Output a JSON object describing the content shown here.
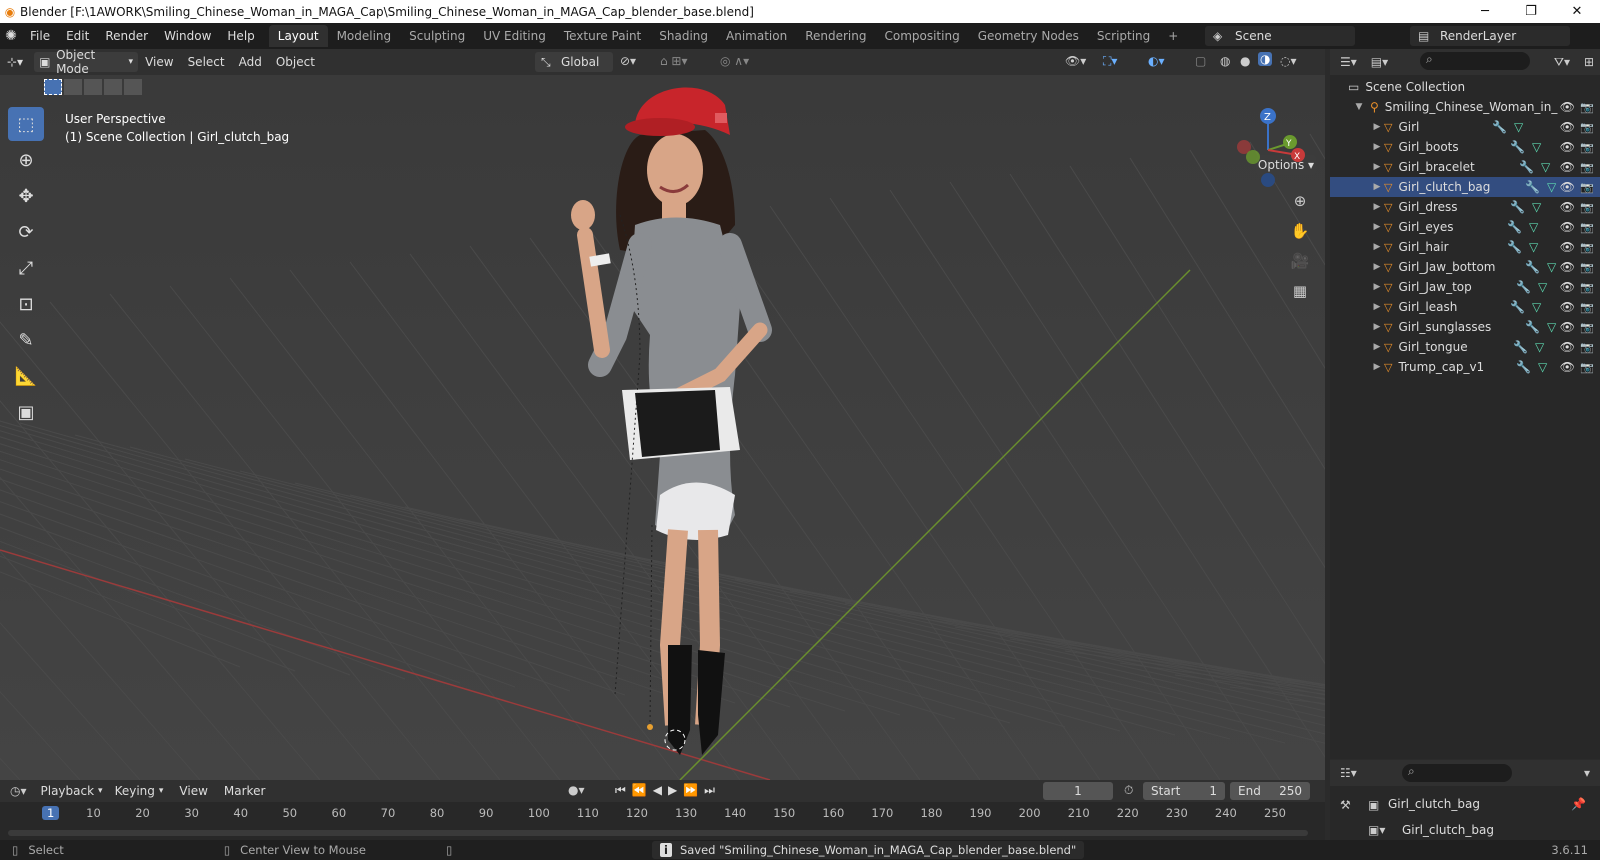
{
  "window": {
    "title": "Blender [F:\\1AWORK\\Smiling_Chinese_Woman_in_MAGA_Cap\\Smiling_Chinese_Woman_in_MAGA_Cap_blender_base.blend]"
  },
  "menu": [
    "File",
    "Edit",
    "Render",
    "Window",
    "Help"
  ],
  "workspaces": [
    "Layout",
    "Modeling",
    "Sculpting",
    "UV Editing",
    "Texture Paint",
    "Shading",
    "Animation",
    "Rendering",
    "Compositing",
    "Geometry Nodes",
    "Scripting"
  ],
  "active_workspace": "Layout",
  "scene": "Scene",
  "render_layer": "RenderLayer",
  "viewport_header": {
    "mode": "Object Mode",
    "menus": [
      "View",
      "Select",
      "Add",
      "Object"
    ],
    "transform": "Global",
    "options": "Options"
  },
  "viewport": {
    "perspective": "User Perspective",
    "collection_info": "(1) Scene Collection | Girl_clutch_bag"
  },
  "gizmo": {
    "z": "Z",
    "y": "Y",
    "x": "X"
  },
  "outliner": {
    "root": "Scene Collection",
    "collection": "Smiling_Chinese_Woman_in_",
    "items": [
      "Girl",
      "Girl_boots",
      "Girl_bracelet",
      "Girl_clutch_bag",
      "Girl_dress",
      "Girl_eyes",
      "Girl_hair",
      "Girl_Jaw_bottom",
      "Girl_Jaw_top",
      "Girl_leash",
      "Girl_sunglasses",
      "Girl_tongue",
      "Trump_cap_v1"
    ],
    "selected": "Girl_clutch_bag"
  },
  "properties": {
    "object": "Girl_clutch_bag",
    "sub": "Girl_clutch_bag"
  },
  "timeline": {
    "menus": [
      "Playback",
      "Keying",
      "View",
      "Marker"
    ],
    "current_frame": "1",
    "start_label": "Start",
    "start": "1",
    "end_label": "End",
    "end": "250",
    "ticks": [
      "1",
      "10",
      "20",
      "30",
      "40",
      "50",
      "60",
      "70",
      "80",
      "90",
      "100",
      "110",
      "120",
      "130",
      "140",
      "150",
      "160",
      "170",
      "180",
      "190",
      "200",
      "210",
      "220",
      "230",
      "240",
      "250"
    ]
  },
  "status": {
    "select": "Select",
    "center": "Center View to Mouse",
    "message": "Saved \"Smiling_Chinese_Woman_in_MAGA_Cap_blender_base.blend\"",
    "version": "3.6.11"
  }
}
